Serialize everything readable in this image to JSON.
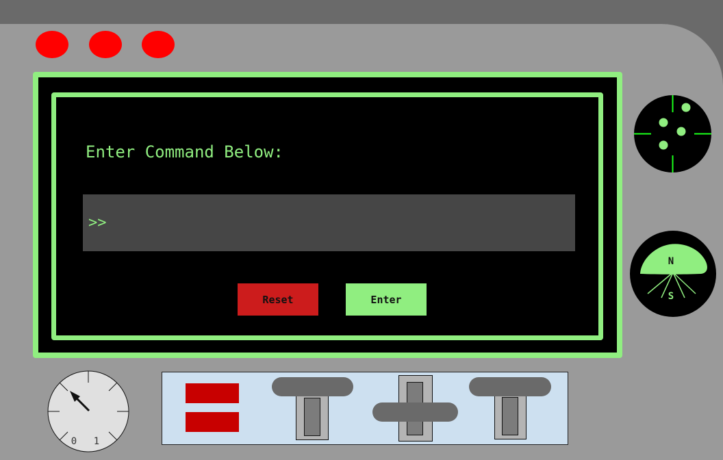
{
  "indicator_lights": [
    {
      "name": "light-1",
      "color": "#ff0000"
    },
    {
      "name": "light-2",
      "color": "#ff0000"
    },
    {
      "name": "light-3",
      "color": "#ff0000"
    }
  ],
  "console": {
    "prompt_label": "Enter Command Below:",
    "input_prefix": ">>",
    "input_value": "",
    "reset_label": "Reset",
    "enter_label": "Enter"
  },
  "compass": {
    "north_label": "N",
    "south_label": "S"
  },
  "gauge": {
    "tick_label_0": "0",
    "tick_label_1": "1"
  },
  "colors": {
    "screen_green": "#90ee80",
    "reset_red": "#cc1c1c",
    "light_red": "#ff0000",
    "panel_gray": "#9a9a9a",
    "control_box_blue": "#cde0f0"
  }
}
